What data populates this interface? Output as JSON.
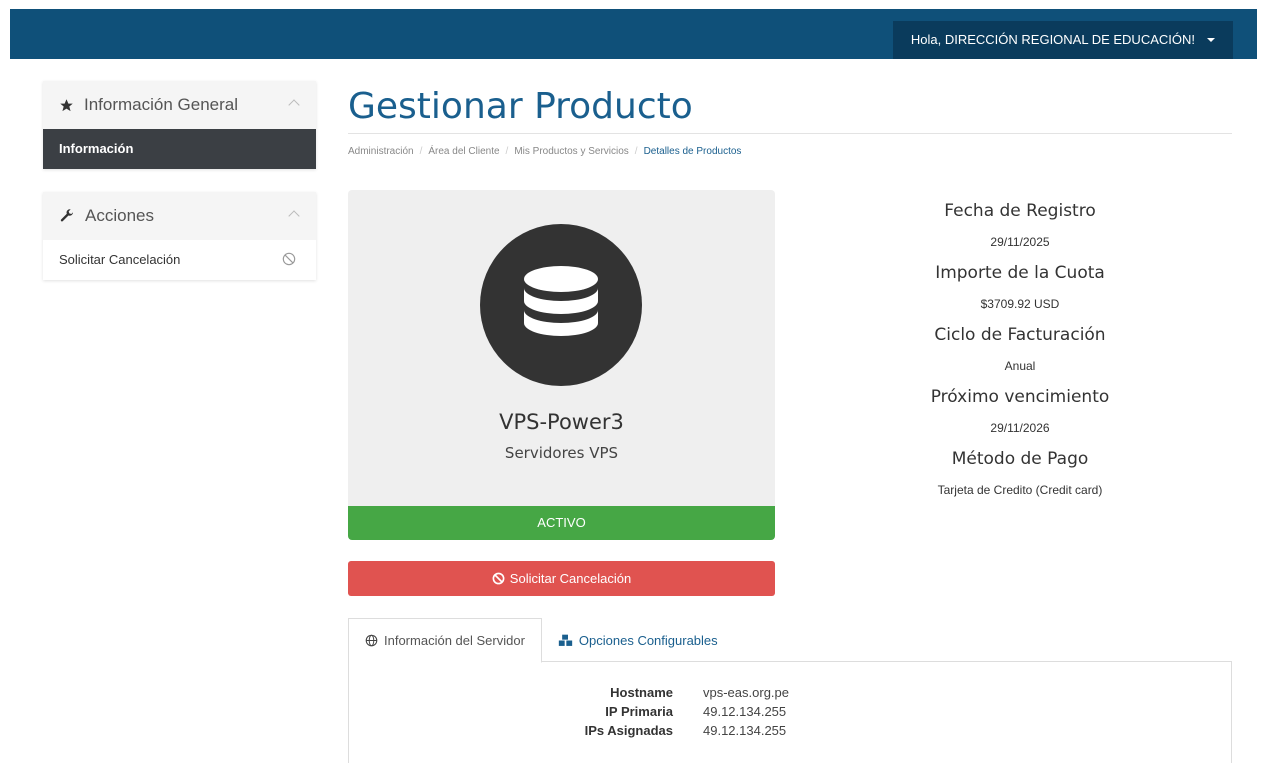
{
  "header": {
    "user_greeting": "Hola, DIRECCIÓN REGIONAL DE EDUCACIÓN!"
  },
  "sidebar": {
    "general": {
      "title": "Información General",
      "active_item": "Información"
    },
    "actions": {
      "title": "Acciones",
      "items": [
        "Solicitar Cancelación"
      ]
    }
  },
  "page": {
    "title": "Gestionar Producto",
    "breadcrumb": [
      "Administración",
      "Área del Cliente",
      "Mis Productos y Servicios",
      "Detalles de Productos"
    ]
  },
  "product": {
    "name": "VPS-Power3",
    "group": "Servidores VPS",
    "status": "ACTIVO",
    "cancel_label": "Solicitar Cancelación"
  },
  "details": [
    {
      "label": "Fecha de Registro",
      "value": "29/11/2025"
    },
    {
      "label": "Importe de la Cuota",
      "value": "$3709.92 USD"
    },
    {
      "label": "Ciclo de Facturación",
      "value": "Anual"
    },
    {
      "label": "Próximo vencimiento",
      "value": "29/11/2026"
    },
    {
      "label": "Método de Pago",
      "value": "Tarjeta de Credito (Credit card)"
    }
  ],
  "tabs": [
    "Información del Servidor",
    "Opciones Configurables"
  ],
  "server_info": [
    {
      "key": "Hostname",
      "value": "vps-eas.org.pe"
    },
    {
      "key": "IP Primaria",
      "value": "49.12.134.255"
    },
    {
      "key": "IPs Asignadas",
      "value": "49.12.134.255"
    }
  ],
  "colors": {
    "topbar": "#0f5079",
    "accent": "#1a5f8e",
    "status_active": "#46a745",
    "danger": "#e05350"
  }
}
